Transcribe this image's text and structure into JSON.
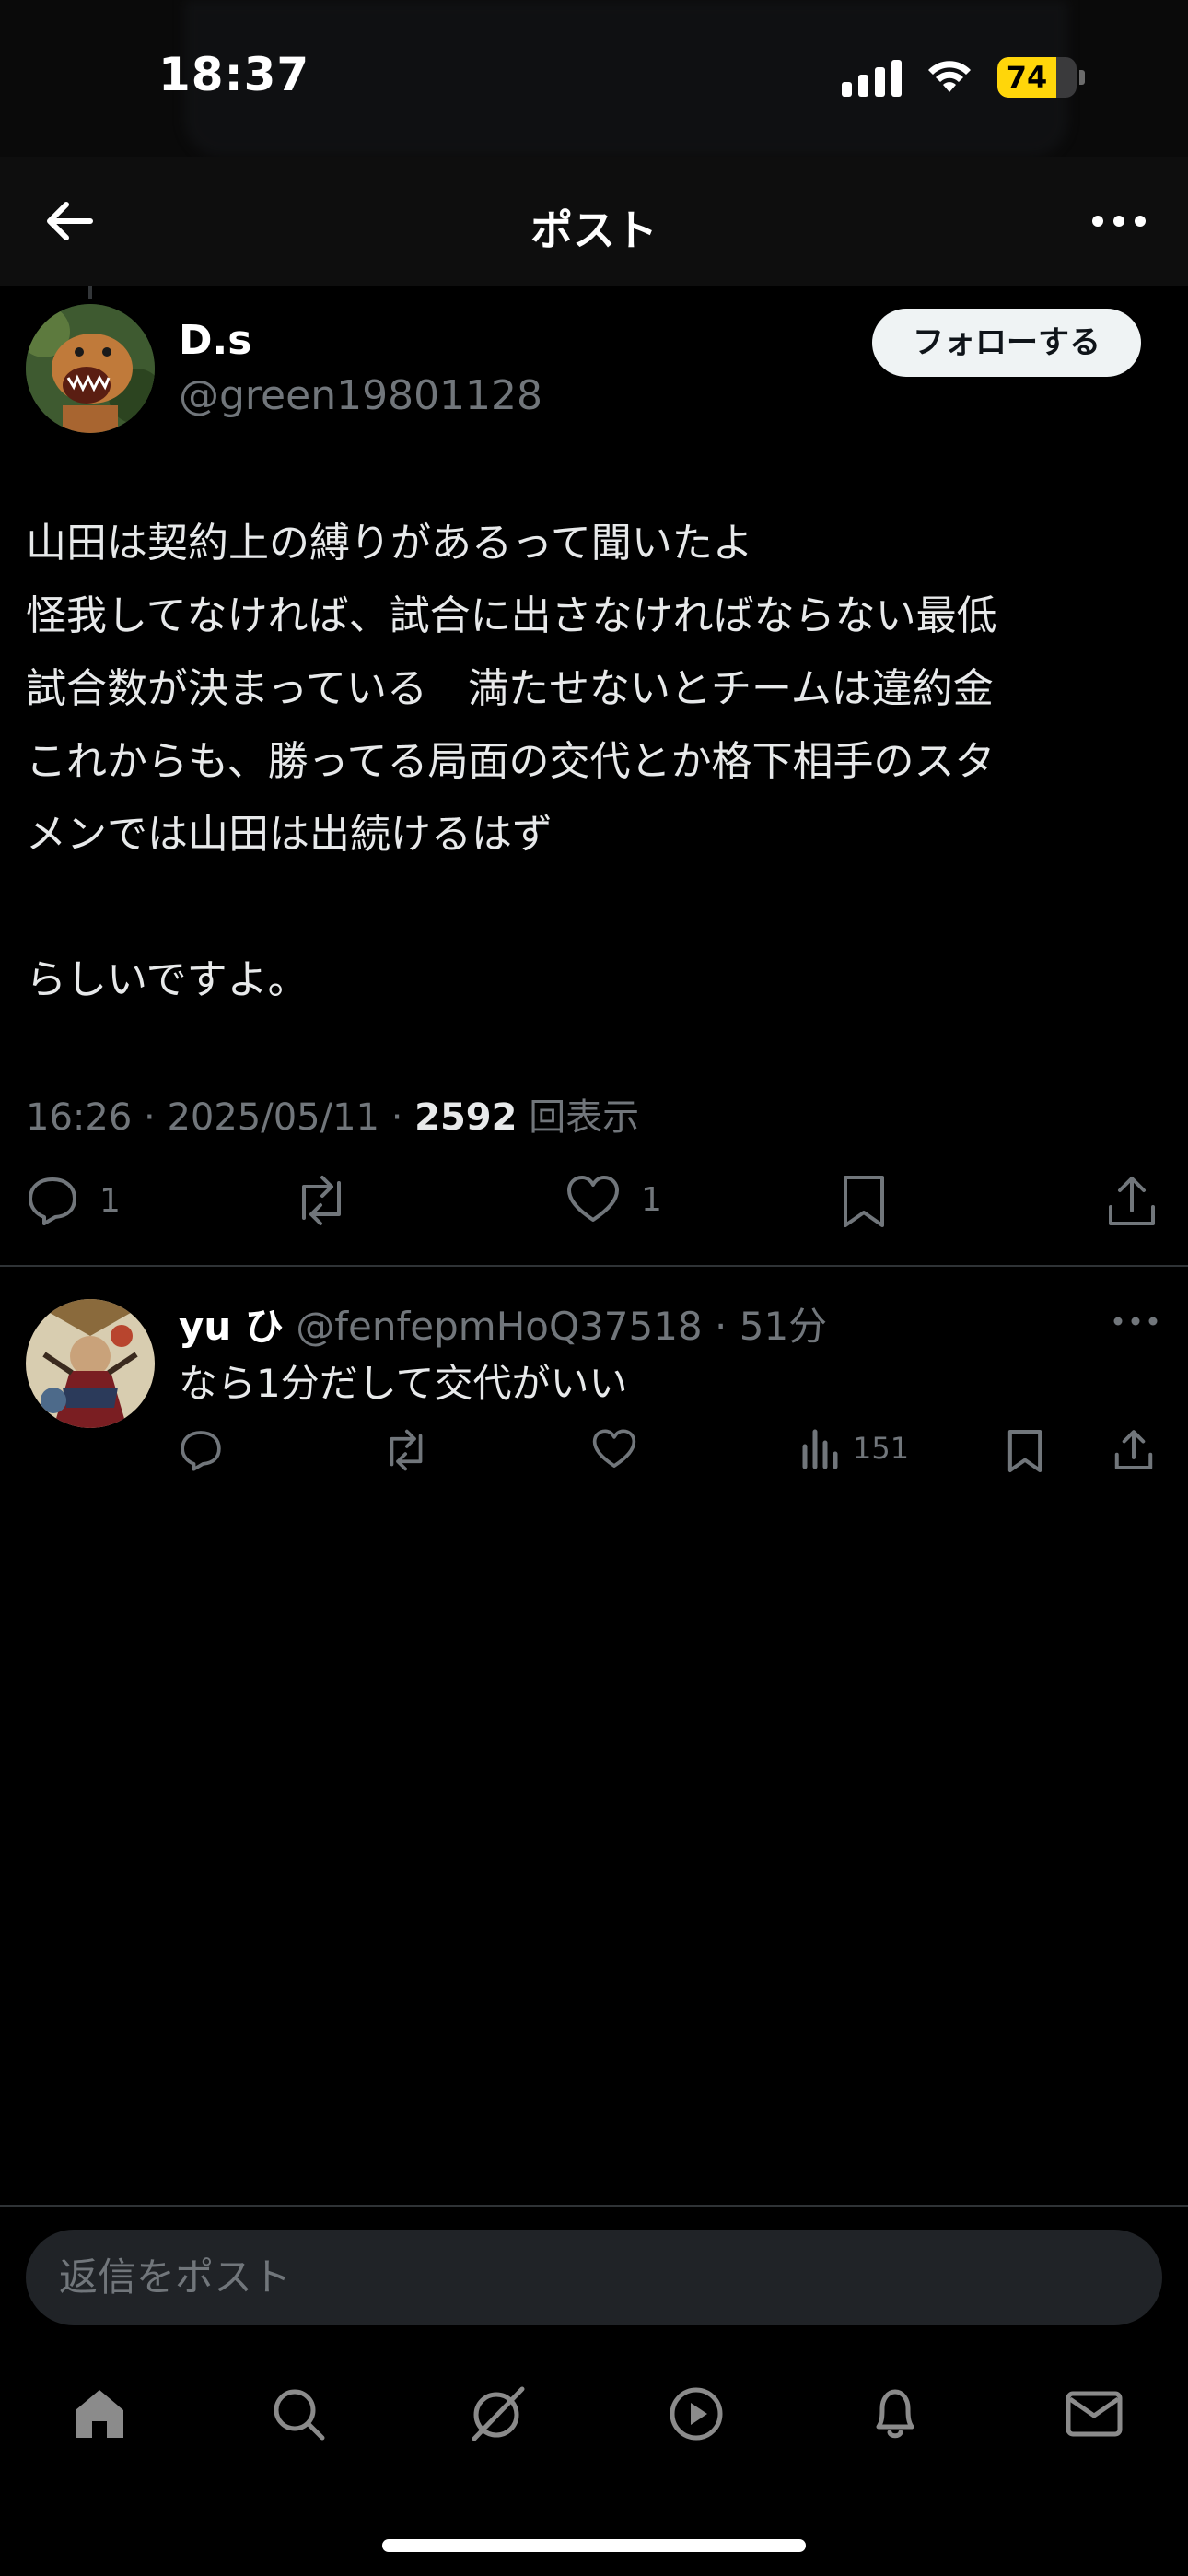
{
  "status_bar": {
    "time": "18:37",
    "battery_level": "74",
    "signal_bars": 4,
    "wifi": true,
    "battery_color": "#ffd60a"
  },
  "header": {
    "title": "ポスト",
    "back_icon": "arrow-left-icon",
    "more_icon": "more-horizontal-icon"
  },
  "post": {
    "author": {
      "display_name": "D.s",
      "handle": "@green19801128",
      "avatar": "dinosaur-avatar"
    },
    "follow_label": "フォローする",
    "body_lines": [
      "山田は契約上の縛りがあるって聞いたよ",
      "怪我してなければ、試合に出さなければならない最低",
      "試合数が決まっている　満たせないとチームは違約金",
      "これからも、勝ってる局面の交代とか格下相手のスタ",
      "メンでは山田は出続けるはず",
      "",
      "らしいですよ。"
    ],
    "meta": {
      "time": "16:26",
      "date": "2025/05/11",
      "views": "2592",
      "views_label": "回表示",
      "separator": "·"
    },
    "actions": {
      "reply_count": "1",
      "repost_count": "",
      "like_count": "1"
    }
  },
  "reply": {
    "display_name": "yu ひ",
    "handle": "@fenfepmHoQ37518",
    "separator": "·",
    "age": "51分",
    "text": "なら1分だして交代がいい",
    "views": "151",
    "avatar": "warrior-art-avatar"
  },
  "composer": {
    "placeholder": "返信をポスト"
  },
  "tabbar": {
    "items": [
      "home-icon",
      "search-icon",
      "grok-icon",
      "play-icon",
      "bell-icon",
      "mail-icon"
    ]
  },
  "colors": {
    "background": "#000000",
    "muted": "#71767b",
    "text": "#e7e9ea",
    "divider": "#2f3336"
  }
}
